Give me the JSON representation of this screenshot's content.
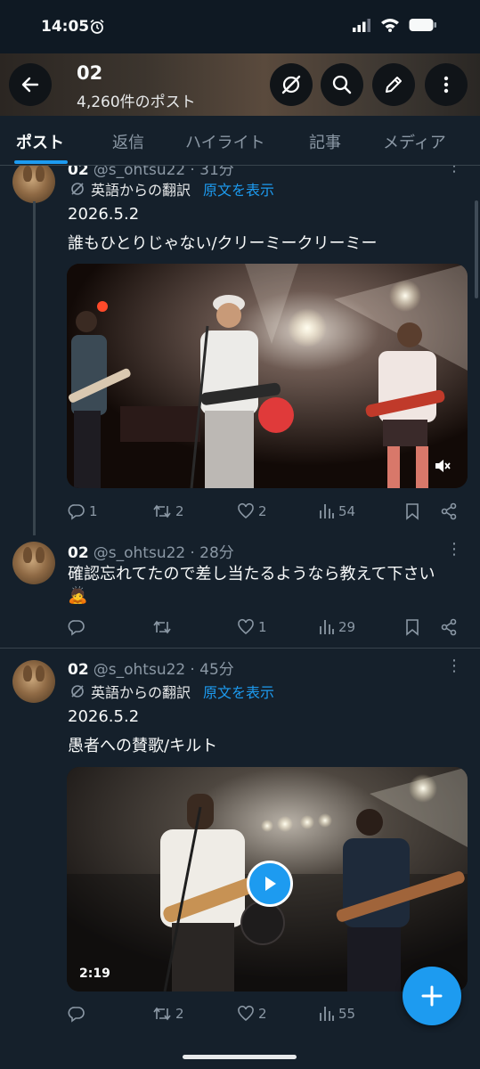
{
  "status_bar": {
    "time": "14:05"
  },
  "header": {
    "title": "02",
    "subtitle": "4,260件のポスト"
  },
  "tabs": [
    {
      "label": "ポスト",
      "active": true
    },
    {
      "label": "返信"
    },
    {
      "label": "ハイライト"
    },
    {
      "label": "記事"
    },
    {
      "label": "メディア"
    }
  ],
  "posts": [
    {
      "name": "02",
      "handle": "@s_ohtsu22",
      "time": "31分",
      "translate_label": "英語からの翻訳",
      "translate_link": "原文を表示",
      "lines": [
        "2026.5.2",
        "誰もひとりじゃない/クリーミークリーミー"
      ],
      "media": {
        "type": "video",
        "muted": true
      },
      "replies": "1",
      "reposts": "2",
      "likes": "2",
      "views": "54"
    },
    {
      "name": "02",
      "handle": "@s_ohtsu22",
      "time": "28分",
      "lines": [
        "確認忘れてたので差し当たるようなら教えて下さい"
      ],
      "emoji": "🙇",
      "replies": "",
      "reposts": "",
      "likes": "1",
      "views": "29"
    },
    {
      "name": "02",
      "handle": "@s_ohtsu22",
      "time": "45分",
      "translate_label": "英語からの翻訳",
      "translate_link": "原文を表示",
      "lines": [
        "2026.5.2",
        "愚者への賛歌/キルト"
      ],
      "media": {
        "type": "video",
        "duration": "2:19"
      },
      "replies": "",
      "reposts": "2",
      "likes": "2",
      "views": "55"
    }
  ],
  "colors": {
    "accent": "#1d9bf0",
    "background": "#15202b",
    "muted": "#8b98a5"
  }
}
